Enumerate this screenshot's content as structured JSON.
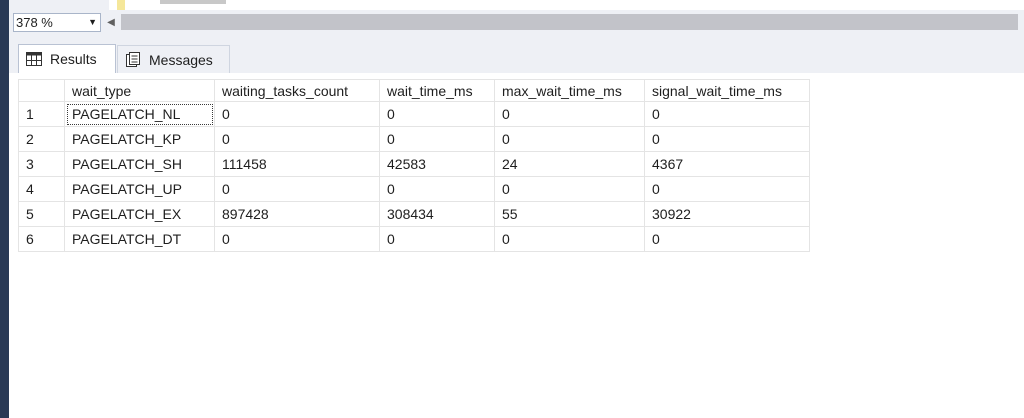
{
  "zoom": {
    "value": "378 %"
  },
  "tabs": [
    {
      "label": "Results",
      "active": true
    },
    {
      "label": "Messages",
      "active": false
    }
  ],
  "grid": {
    "columns": [
      "wait_type",
      "waiting_tasks_count",
      "wait_time_ms",
      "max_wait_time_ms",
      "signal_wait_time_ms"
    ],
    "rows": [
      {
        "num": "1",
        "cells": [
          "PAGELATCH_NL",
          "0",
          "0",
          "0",
          "0"
        ]
      },
      {
        "num": "2",
        "cells": [
          "PAGELATCH_KP",
          "0",
          "0",
          "0",
          "0"
        ]
      },
      {
        "num": "3",
        "cells": [
          "PAGELATCH_SH",
          "111458",
          "42583",
          "24",
          "4367"
        ]
      },
      {
        "num": "4",
        "cells": [
          "PAGELATCH_UP",
          "0",
          "0",
          "0",
          "0"
        ]
      },
      {
        "num": "5",
        "cells": [
          "PAGELATCH_EX",
          "897428",
          "308434",
          "55",
          "30922"
        ]
      },
      {
        "num": "6",
        "cells": [
          "PAGELATCH_DT",
          "0",
          "0",
          "0",
          "0"
        ]
      }
    ]
  },
  "colors": {
    "accent": "#293955",
    "tab_bg": "#eef0f5"
  }
}
